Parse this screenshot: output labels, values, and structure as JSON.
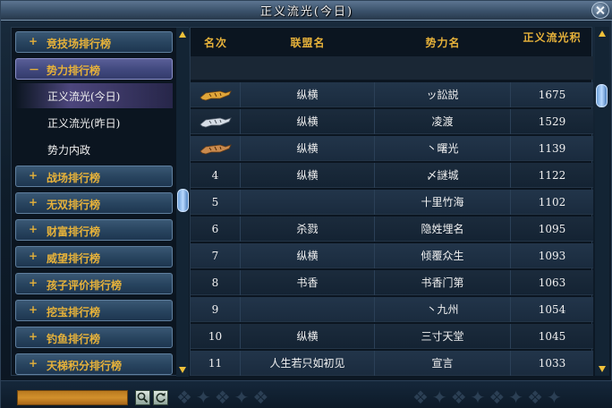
{
  "window": {
    "title": "正义流光(今日)"
  },
  "categories": [
    {
      "sign": "+",
      "label": "竞技场排行榜",
      "state": "collapsed"
    },
    {
      "sign": "－",
      "label": "势力排行榜",
      "state": "expanded"
    },
    {
      "sign": "+",
      "label": "战场排行榜",
      "state": "collapsed"
    },
    {
      "sign": "+",
      "label": "无双排行榜",
      "state": "collapsed"
    },
    {
      "sign": "+",
      "label": "财富排行榜",
      "state": "collapsed"
    },
    {
      "sign": "+",
      "label": "威望排行榜",
      "state": "collapsed"
    },
    {
      "sign": "+",
      "label": "孩子评价排行榜",
      "state": "collapsed"
    },
    {
      "sign": "+",
      "label": "挖宝排行榜",
      "state": "collapsed"
    },
    {
      "sign": "+",
      "label": "钓鱼排行榜",
      "state": "collapsed"
    },
    {
      "sign": "+",
      "label": "天梯积分排行榜",
      "state": "collapsed"
    }
  ],
  "subitems": [
    {
      "label": "正义流光(今日)",
      "active": true
    },
    {
      "label": "正义流光(昨日)",
      "active": false
    },
    {
      "label": "势力内政",
      "active": false
    }
  ],
  "table": {
    "headers": {
      "rank": "名次",
      "alliance": "联盟名",
      "faction": "势力名",
      "score": "正义流光积"
    },
    "rows": [
      {
        "rank": "",
        "medal": "gold-tiger-icon",
        "alliance": "纵横",
        "faction": "ッ訟説",
        "score": "1675"
      },
      {
        "rank": "",
        "medal": "silver-tiger-icon",
        "alliance": "纵横",
        "faction": "凌渡",
        "score": "1529"
      },
      {
        "rank": "",
        "medal": "bronze-tiger-icon",
        "alliance": "纵横",
        "faction": "丶曙光",
        "score": "1139"
      },
      {
        "rank": "4",
        "medal": "",
        "alliance": "纵横",
        "faction": "〆謎城",
        "score": "1122"
      },
      {
        "rank": "5",
        "medal": "",
        "alliance": "",
        "faction": "十里竹海",
        "score": "1102"
      },
      {
        "rank": "6",
        "medal": "",
        "alliance": "杀戮",
        "faction": "隐姓埋名",
        "score": "1095"
      },
      {
        "rank": "7",
        "medal": "",
        "alliance": "纵横",
        "faction": "倾覆众生",
        "score": "1093"
      },
      {
        "rank": "8",
        "medal": "",
        "alliance": "书香",
        "faction": "书香门第",
        "score": "1063"
      },
      {
        "rank": "9",
        "medal": "",
        "alliance": "",
        "faction": "丶九州",
        "score": "1054"
      },
      {
        "rank": "10",
        "medal": "",
        "alliance": "纵横",
        "faction": "三寸天堂",
        "score": "1045"
      },
      {
        "rank": "11",
        "medal": "",
        "alliance": "人生若只如初见",
        "faction": "宣言",
        "score": "1033"
      }
    ]
  },
  "colors": {
    "header_gold": "#e7b23a",
    "category_text": "#e7b23a",
    "active_sub": "#8c78d2"
  }
}
